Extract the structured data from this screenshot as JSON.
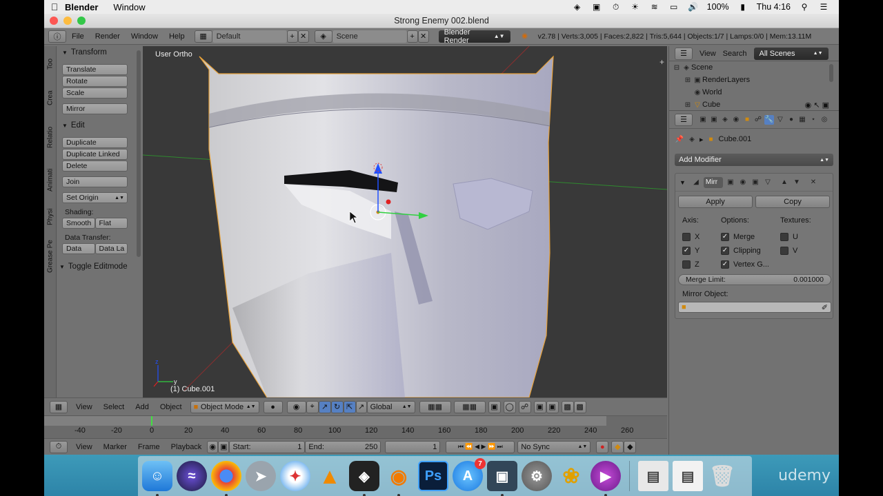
{
  "menubar": {
    "app_name": "Blender",
    "menu_window": "Window",
    "battery": "100%",
    "clock": "Thu 4:16"
  },
  "window": {
    "title": "Strong Enemy 002.blend"
  },
  "header": {
    "menus": [
      "File",
      "Render",
      "Window",
      "Help"
    ],
    "layout": "Default",
    "scene": "Scene",
    "engine": "Blender Render",
    "stats": "v2.78 | Verts:3,005 | Faces:2,822 | Tris:5,644 | Objects:1/7 | Lamps:0/0 | Mem:13.11M"
  },
  "tabs": [
    "Too",
    "Crea",
    "Relatio",
    "Animati",
    "Physi",
    "Grease Pe"
  ],
  "toolshelf": {
    "transform_title": "Transform",
    "translate": "Translate",
    "rotate": "Rotate",
    "scale": "Scale",
    "mirror": "Mirror",
    "edit_title": "Edit",
    "duplicate": "Duplicate",
    "duplicate_linked": "Duplicate Linked",
    "delete": "Delete",
    "join": "Join",
    "set_origin": "Set Origin",
    "shading_label": "Shading:",
    "smooth": "Smooth",
    "flat": "Flat",
    "data_transfer_label": "Data Transfer:",
    "data": "Data",
    "data_layout": "Data La",
    "toggle_editmode": "Toggle Editmode"
  },
  "viewport": {
    "view_label": "User Ortho",
    "object_label": "(1) Cube.001",
    "axis_z": "z",
    "axis_y": "y"
  },
  "view3d_header": {
    "view": "View",
    "select": "Select",
    "add": "Add",
    "object": "Object",
    "mode": "Object Mode",
    "orientation": "Global"
  },
  "timeline": {
    "ticks": [
      "-40",
      "-20",
      "0",
      "20",
      "40",
      "60",
      "80",
      "100",
      "120",
      "140",
      "160",
      "180",
      "200",
      "220",
      "240",
      "260"
    ],
    "current_frame_marker": 0,
    "view": "View",
    "marker": "Marker",
    "frame": "Frame",
    "playback": "Playback",
    "start_label": "Start:",
    "start_value": "1",
    "end_label": "End:",
    "end_value": "250",
    "current_frame": "1",
    "sync": "No Sync"
  },
  "outliner": {
    "view": "View",
    "search": "Search",
    "filter": "All Scenes",
    "items": [
      "Scene",
      "RenderLayers",
      "World",
      "Cube"
    ]
  },
  "properties": {
    "object_name": "Cube.001",
    "add_modifier": "Add Modifier",
    "modifier_name": "Mirr",
    "apply": "Apply",
    "copy": "Copy",
    "axis_label": "Axis:",
    "options_label": "Options:",
    "textures_label": "Textures:",
    "x": "X",
    "y": "Y",
    "z": "Z",
    "merge": "Merge",
    "clipping": "Clipping",
    "vertex_groups": "Vertex G...",
    "u": "U",
    "v": "V",
    "merge_limit_label": "Merge Limit:",
    "merge_limit_value": "0.001000",
    "mirror_object_label": "Mirror Object:"
  },
  "dock": {
    "photoshop": "Ps",
    "appstore_badge": "7",
    "watermark": "udemy"
  },
  "colors": {
    "blender_bg": "#727272",
    "viewport_bg": "#393939",
    "select_outline": "#e8a23a",
    "dock_bg": "#3d9ab9"
  }
}
